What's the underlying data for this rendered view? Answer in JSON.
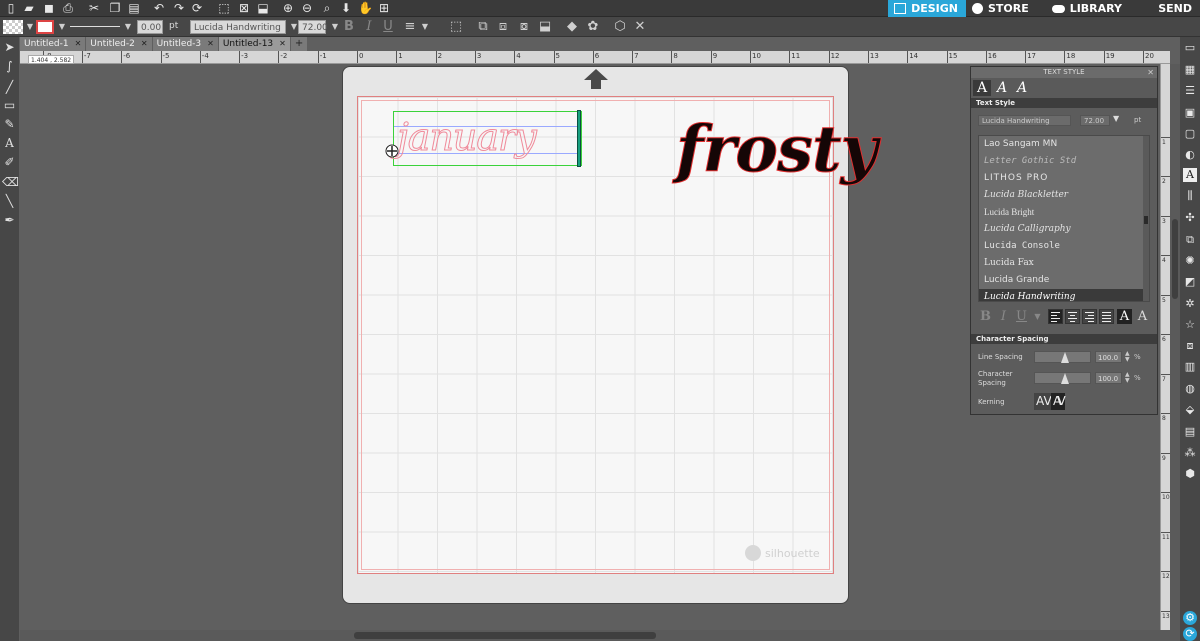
{
  "nav": {
    "design": "DESIGN",
    "store": "STORE",
    "library": "LIBRARY",
    "send": "SEND"
  },
  "props": {
    "line_width": "0.00",
    "line_unit": "pt",
    "font": "Lucida Handwriting",
    "font_size": "72.00"
  },
  "tabs": [
    {
      "label": "Untitled-1"
    },
    {
      "label": "Untitled-2"
    },
    {
      "label": "Untitled-3"
    },
    {
      "label": "Untitled-13"
    }
  ],
  "coords": "1.404 , 2.582",
  "ruler_h": [
    "-8",
    "-7",
    "-6",
    "-5",
    "-4",
    "-3",
    "-2",
    "-1",
    "0",
    "1",
    "2",
    "3",
    "4",
    "5",
    "6",
    "7",
    "8",
    "9",
    "10",
    "11",
    "12",
    "13",
    "14",
    "15",
    "16",
    "17",
    "18",
    "19",
    "20"
  ],
  "ruler_v": [
    "1",
    "2",
    "3",
    "4",
    "5",
    "6",
    "7",
    "8",
    "9",
    "10",
    "11",
    "12",
    "13",
    "14",
    "15",
    "16"
  ],
  "canvas": {
    "text1": "january",
    "text2": "frosty",
    "brand": "silhouette"
  },
  "panel": {
    "title": "TEXT STYLE",
    "section_text": "Text Style",
    "font": "Lucida Handwriting",
    "size": "72.00",
    "unit": "pt",
    "fonts": [
      "Lao Sangam MN",
      "Letter Gothic Std",
      "Lithos Pro",
      "Lucida Blackletter",
      "Lucida Bright",
      "Lucida Calligraphy",
      "Lucida Console",
      "Lucida Fax",
      "Lucida Grande",
      "Lucida Handwriting"
    ],
    "selected_font": "Lucida Handwriting",
    "section_spacing": "Character Spacing",
    "line_spacing_label": "Line Spacing",
    "line_spacing": "100.0",
    "char_spacing_label_1": "Character",
    "char_spacing_label_2": "Spacing",
    "char_spacing": "100.0",
    "pct": "%",
    "kerning_label": "Kerning",
    "kern_a": "AV",
    "kern_b": "AV"
  },
  "colors": {
    "accent": "#2aa7d9",
    "frosty_fill": "#150606",
    "cut_line": "#e08080"
  }
}
